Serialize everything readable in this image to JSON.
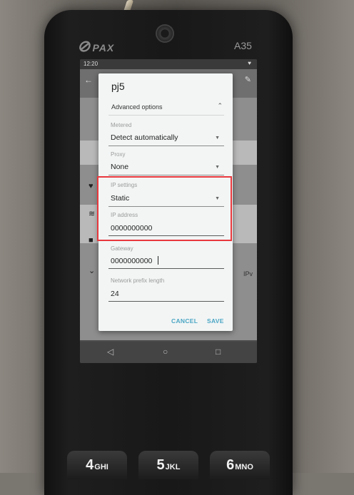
{
  "device": {
    "model": "A35",
    "brand": "PAX"
  },
  "status_bar": {
    "time": "12:20"
  },
  "dialog": {
    "title": "pj5",
    "advanced_options_label": "Advanced options",
    "metered": {
      "label": "Metered",
      "value": "Detect automatically"
    },
    "proxy": {
      "label": "Proxy",
      "value": "None"
    },
    "ip_settings": {
      "label": "IP settings",
      "value": "Static"
    },
    "ip_address": {
      "label": "IP address",
      "value": "0000000000"
    },
    "gateway": {
      "label": "Gateway",
      "value": "0000000000"
    },
    "prefix_length": {
      "label": "Network prefix length",
      "value": "24"
    },
    "cancel_label": "CANCEL",
    "save_label": "SAVE"
  },
  "background": {
    "partial_text": "IPv"
  },
  "keypad": [
    {
      "digit": "4",
      "letters": "GHI"
    },
    {
      "digit": "5",
      "letters": "JKL"
    },
    {
      "digit": "6",
      "letters": "MNO"
    }
  ],
  "colors": {
    "accent": "#4aa6c4",
    "highlight": "#e8383d"
  }
}
